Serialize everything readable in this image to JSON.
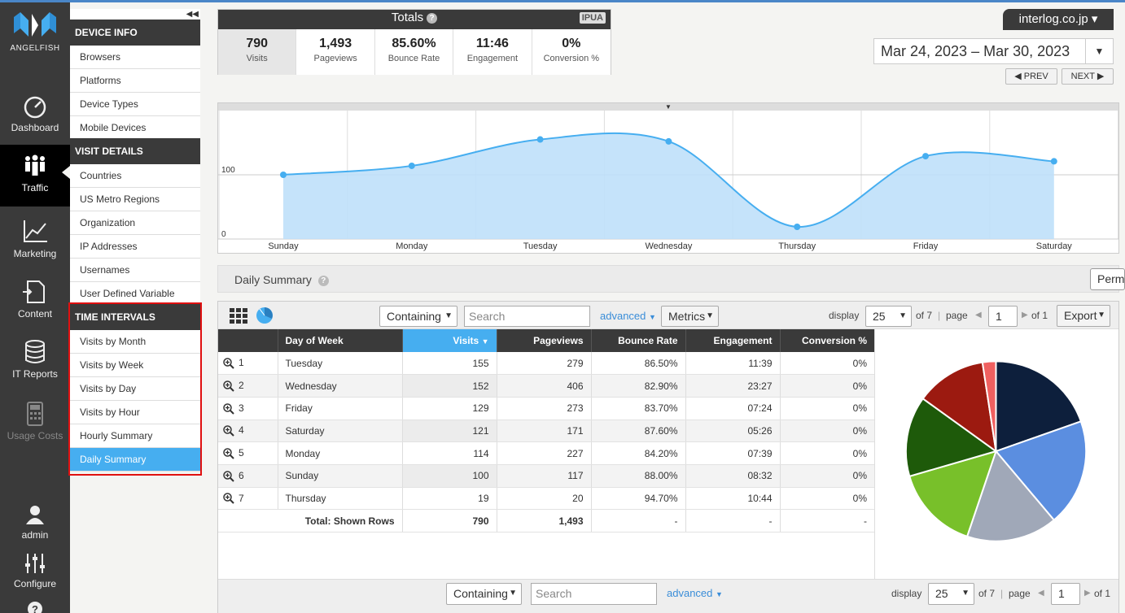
{
  "brand": {
    "name": "ANGELFISH"
  },
  "leftnav": [
    {
      "label": "Dashboard",
      "icon": "gauge-icon"
    },
    {
      "label": "Traffic",
      "icon": "people-icon"
    },
    {
      "label": "Marketing",
      "icon": "line-chart-icon"
    },
    {
      "label": "Content",
      "icon": "document-icon"
    },
    {
      "label": "IT Reports",
      "icon": "database-icon"
    },
    {
      "label": "Usage Costs",
      "icon": "calculator-icon"
    },
    {
      "label": "admin",
      "icon": "user-icon"
    },
    {
      "label": "Configure",
      "icon": "sliders-icon"
    }
  ],
  "subnav": {
    "collapse": "◀◀",
    "device_info": {
      "title": "DEVICE INFO",
      "items": [
        "Browsers",
        "Platforms",
        "Device Types",
        "Mobile Devices"
      ]
    },
    "visit_details": {
      "title": "VISIT DETAILS",
      "items": [
        "Countries",
        "US Metro Regions",
        "Organization",
        "IP Addresses",
        "Usernames",
        "User Defined Variable"
      ]
    },
    "time_intervals": {
      "title": "TIME INTERVALS",
      "items": [
        "Visits by Month",
        "Visits by Week",
        "Visits by Day",
        "Visits by Hour",
        "Hourly Summary",
        "Daily Summary"
      ]
    }
  },
  "totals": {
    "title": "Totals",
    "badge": "IPUA",
    "metrics": [
      {
        "value": "790",
        "label": "Visits"
      },
      {
        "value": "1,493",
        "label": "Pageviews"
      },
      {
        "value": "85.60%",
        "label": "Bounce Rate"
      },
      {
        "value": "11:46",
        "label": "Engagement"
      },
      {
        "value": "0%",
        "label": "Conversion %"
      }
    ]
  },
  "account": {
    "name": "interlog.co.jp"
  },
  "daterange": {
    "value": "Mar 24, 2023 – Mar 30, 2023",
    "prev": "PREV",
    "next": "NEXT"
  },
  "chart_data": {
    "type": "area",
    "categories": [
      "Sunday",
      "Monday",
      "Tuesday",
      "Wednesday",
      "Thursday",
      "Friday",
      "Saturday"
    ],
    "values": [
      100,
      114,
      155,
      152,
      19,
      129,
      121
    ],
    "yticks": [
      "100",
      "0"
    ],
    "ylim": [
      0,
      200
    ],
    "grid": true,
    "color": "#46aef0"
  },
  "section": {
    "title": "Daily Summary",
    "perma": "Perma"
  },
  "toolbar": {
    "filter": "Containing",
    "search_placeholder": "Search",
    "advanced": "advanced",
    "metrics": "Metrics",
    "display_label": "display",
    "display_value": "25",
    "of_pages": "of 7",
    "page_label": "page",
    "page_value": "1",
    "of_total": "of 1",
    "export": "Export"
  },
  "table": {
    "headers": [
      "Day of Week",
      "Visits",
      "Pageviews",
      "Bounce Rate",
      "Engagement",
      "Conversion %"
    ],
    "rows": [
      {
        "n": "1",
        "day": "Tuesday",
        "visits": "155",
        "pageviews": "279",
        "bounce": "86.50%",
        "eng": "11:39",
        "conv": "0%"
      },
      {
        "n": "2",
        "day": "Wednesday",
        "visits": "152",
        "pageviews": "406",
        "bounce": "82.90%",
        "eng": "23:27",
        "conv": "0%"
      },
      {
        "n": "3",
        "day": "Friday",
        "visits": "129",
        "pageviews": "273",
        "bounce": "83.70%",
        "eng": "07:24",
        "conv": "0%"
      },
      {
        "n": "4",
        "day": "Saturday",
        "visits": "121",
        "pageviews": "171",
        "bounce": "87.60%",
        "eng": "05:26",
        "conv": "0%"
      },
      {
        "n": "5",
        "day": "Monday",
        "visits": "114",
        "pageviews": "227",
        "bounce": "84.20%",
        "eng": "07:39",
        "conv": "0%"
      },
      {
        "n": "6",
        "day": "Sunday",
        "visits": "100",
        "pageviews": "117",
        "bounce": "88.00%",
        "eng": "08:32",
        "conv": "0%"
      },
      {
        "n": "7",
        "day": "Thursday",
        "visits": "19",
        "pageviews": "20",
        "bounce": "94.70%",
        "eng": "10:44",
        "conv": "0%"
      }
    ],
    "total": {
      "label": "Total: Shown Rows",
      "visits": "790",
      "pageviews": "1,493",
      "bounce": "-",
      "eng": "-",
      "conv": "-"
    }
  },
  "pie": {
    "values": [
      155,
      152,
      129,
      121,
      114,
      100,
      19
    ],
    "colors": [
      "#0d1f3c",
      "#5b8ee0",
      "#a0a8b8",
      "#78c02a",
      "#1e5a0a",
      "#9c1a10",
      "#f06060"
    ]
  }
}
